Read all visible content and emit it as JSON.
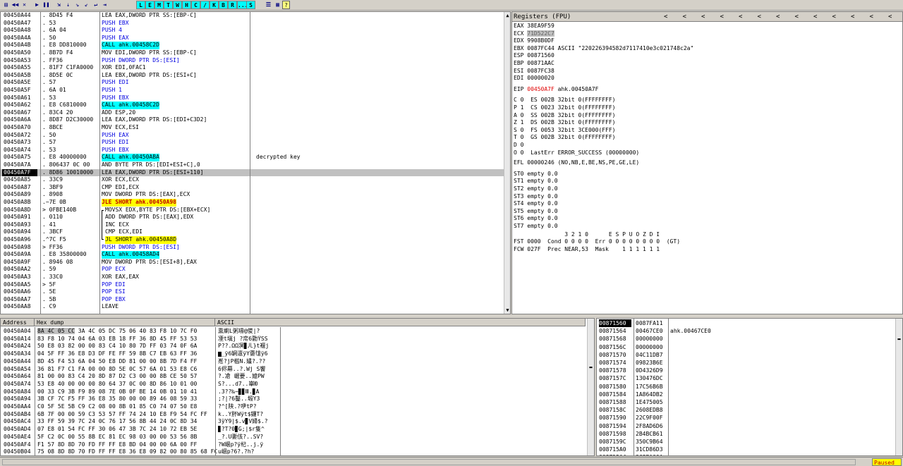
{
  "toolbar": {
    "icons": [
      "folder-open-icon",
      "rewind-icon",
      "close-icon",
      "run-icon",
      "pause-icon",
      "step-into-icon",
      "step-over-icon",
      "trace-into-icon",
      "trace-over-icon",
      "execute-till-return-icon",
      "goto-icon"
    ],
    "letters": [
      "L",
      "E",
      "M",
      "T",
      "W",
      "H",
      "C",
      "/",
      "K",
      "B",
      "R",
      "...",
      "S"
    ],
    "help": "?"
  },
  "disasm": {
    "rows": [
      {
        "addr": "00450A44",
        "hex": ". 8D45 F4",
        "asm": "LEA EAX,DWORD PTR SS:[EBP-C]",
        "kind": "hlmem",
        "cmt": ""
      },
      {
        "addr": "00450A47",
        "hex": ". 53",
        "asm": "PUSH EBX",
        "kind": "push",
        "cmt": ""
      },
      {
        "addr": "00450A48",
        "hex": ". 6A 04",
        "asm": "PUSH 4",
        "kind": "push",
        "cmt": ""
      },
      {
        "addr": "00450A4A",
        "hex": ". 50",
        "asm": "PUSH EAX",
        "kind": "push",
        "cmt": ""
      },
      {
        "addr": "00450A4B",
        "hex": ". E8 DD810000",
        "asm": "CALL ahk.00458C2D",
        "kind": "call",
        "cmt": ""
      },
      {
        "addr": "00450A50",
        "hex": ". 8B7D F4",
        "asm": "MOV EDI,DWORD PTR SS:[EBP-C]",
        "kind": "hlmem2",
        "cmt": ""
      },
      {
        "addr": "00450A53",
        "hex": ". FF36",
        "asm": "PUSH DWORD PTR DS:[ESI]",
        "kind": "push",
        "cmt": ""
      },
      {
        "addr": "00450A55",
        "hex": ". 81F7 C1FA0000",
        "asm": "XOR EDI,0FAC1",
        "kind": "xorimm",
        "cmt": ""
      },
      {
        "addr": "00450A5B",
        "hex": ". 8D5E 0C",
        "asm": "LEA EBX,DWORD PTR DS:[ESI+C]",
        "kind": "plain",
        "cmt": ""
      },
      {
        "addr": "00450A5E",
        "hex": ". 57",
        "asm": "PUSH EDI",
        "kind": "push",
        "cmt": ""
      },
      {
        "addr": "00450A5F",
        "hex": ". 6A 01",
        "asm": "PUSH 1",
        "kind": "push",
        "cmt": ""
      },
      {
        "addr": "00450A61",
        "hex": ". 53",
        "asm": "PUSH EBX",
        "kind": "push",
        "cmt": ""
      },
      {
        "addr": "00450A62",
        "hex": ". E8 C6810000",
        "asm": "CALL ahk.00458C2D",
        "kind": "call",
        "cmt": ""
      },
      {
        "addr": "00450A67",
        "hex": ". 83C4 20",
        "asm": "ADD ESP,20",
        "kind": "addimm",
        "cmt": ""
      },
      {
        "addr": "00450A6A",
        "hex": ". 8D87 D2C30000",
        "asm": "LEA EAX,DWORD PTR DS:[EDI+C3D2]",
        "kind": "plain",
        "cmt": ""
      },
      {
        "addr": "00450A70",
        "hex": ". 8BCE",
        "asm": "MOV ECX,ESI",
        "kind": "plain",
        "cmt": ""
      },
      {
        "addr": "00450A72",
        "hex": ". 50",
        "asm": "PUSH EAX",
        "kind": "push",
        "cmt": ""
      },
      {
        "addr": "00450A73",
        "hex": ". 57",
        "asm": "PUSH EDI",
        "kind": "push",
        "cmt": ""
      },
      {
        "addr": "00450A74",
        "hex": ". 53",
        "asm": "PUSH EBX",
        "kind": "push",
        "cmt": ""
      },
      {
        "addr": "00450A75",
        "hex": ". E8 40000000",
        "asm": "CALL ahk.00450ABA",
        "kind": "call",
        "cmt": "decrypted key"
      },
      {
        "addr": "00450A7A",
        "hex": ". 806437 0C 00",
        "asm": "AND BYTE PTR DS:[EDI+ESI+C],0",
        "kind": "plain",
        "cmt": ""
      },
      {
        "addr": "00450A7F",
        "hex": ". 8D86 10010000",
        "asm": "LEA EAX,DWORD PTR DS:[ESI+110]",
        "kind": "plain",
        "cmt": "",
        "current": true
      },
      {
        "addr": "00450A85",
        "hex": ". 33C9",
        "asm": "XOR ECX,ECX",
        "kind": "plain",
        "cmt": ""
      },
      {
        "addr": "00450A87",
        "hex": ". 3BF9",
        "asm": "CMP EDI,ECX",
        "kind": "plain",
        "cmt": ""
      },
      {
        "addr": "00450A89",
        "hex": ". 8908",
        "asm": "MOV DWORD PTR DS:[EAX],ECX",
        "kind": "plain",
        "cmt": ""
      },
      {
        "addr": "00450A8B",
        "hex": ".~7E 0B",
        "asm": "JLE SHORT ahk.00450A98",
        "kind": "jmp",
        "cmt": ""
      },
      {
        "addr": "00450A8D",
        "hex": "> 0FBE140B",
        "asm": "MOVSX EDX,BYTE PTR DS:[EBX+ECX]",
        "kind": "loop",
        "cmt": ""
      },
      {
        "addr": "00450A91",
        "hex": ". 0110",
        "asm": "ADD DWORD PTR DS:[EAX],EDX",
        "kind": "loop",
        "cmt": ""
      },
      {
        "addr": "00450A93",
        "hex": ". 41",
        "asm": "INC ECX",
        "kind": "loop",
        "cmt": ""
      },
      {
        "addr": "00450A94",
        "hex": ". 3BCF",
        "asm": "CMP ECX,EDI",
        "kind": "loop",
        "cmt": ""
      },
      {
        "addr": "00450A96",
        "hex": ".^7C F5",
        "asm": "JL SHORT ahk.00450A8D",
        "kind": "jmploop",
        "cmt": ""
      },
      {
        "addr": "00450A98",
        "hex": "> FF36",
        "asm": "PUSH DWORD PTR DS:[ESI]",
        "kind": "push",
        "cmt": ""
      },
      {
        "addr": "00450A9A",
        "hex": ". E8 35800000",
        "asm": "CALL ahk.00458AD4",
        "kind": "call",
        "cmt": ""
      },
      {
        "addr": "00450A9F",
        "hex": ". 8946 08",
        "asm": "MOV DWORD PTR DS:[ESI+8],EAX",
        "kind": "plain",
        "cmt": ""
      },
      {
        "addr": "00450AA2",
        "hex": ". 59",
        "asm": "POP ECX",
        "kind": "push",
        "cmt": ""
      },
      {
        "addr": "00450AA3",
        "hex": ". 33C0",
        "asm": "XOR EAX,EAX",
        "kind": "plain",
        "cmt": ""
      },
      {
        "addr": "00450AA5",
        "hex": "> 5F",
        "asm": "POP EDI",
        "kind": "push",
        "cmt": ""
      },
      {
        "addr": "00450AA6",
        "hex": ". 5E",
        "asm": "POP ESI",
        "kind": "push",
        "cmt": ""
      },
      {
        "addr": "00450AA7",
        "hex": ". 5B",
        "asm": "POP EBX",
        "kind": "push",
        "cmt": ""
      },
      {
        "addr": "00450AA8",
        "hex": ". C9",
        "asm": "LEAVE",
        "kind": "plain",
        "cmt": ""
      }
    ]
  },
  "registers": {
    "title": "Registers (FPU)",
    "arrows": [
      "<",
      "<",
      "<",
      "<",
      "<",
      "<",
      "<",
      "<",
      "<",
      "<",
      "<",
      "<",
      "<",
      "<"
    ],
    "gp": [
      {
        "name": "EAX",
        "value": "38EA9F59",
        "note": "",
        "style": ""
      },
      {
        "name": "ECX",
        "value": "71D522C7",
        "note": "",
        "style": "gray"
      },
      {
        "name": "EDX",
        "value": "9908B0DF",
        "note": "",
        "style": ""
      },
      {
        "name": "EBX",
        "value": "0087FC44",
        "note": "ASCII \"220226394582d7117410e3c021748c2a\"",
        "style": ""
      },
      {
        "name": "ESP",
        "value": "00871560",
        "note": "",
        "style": ""
      },
      {
        "name": "EBP",
        "value": "00871AAC",
        "note": "",
        "style": ""
      },
      {
        "name": "ESI",
        "value": "0087FC38",
        "note": "",
        "style": ""
      },
      {
        "name": "EDI",
        "value": "00000020",
        "note": "",
        "style": ""
      }
    ],
    "eip": {
      "name": "EIP",
      "value": "00450A7F",
      "note": "ahk.00450A7F"
    },
    "flags": [
      "C 0  ES 002B 32bit 0(FFFFFFFF)",
      "P 1  CS 0023 32bit 0(FFFFFFFF)",
      "A 0  SS 002B 32bit 0(FFFFFFFF)",
      "Z 1  DS 002B 32bit 0(FFFFFFFF)",
      "S 0  FS 0053 32bit 3CE000(FFF)",
      "T 0  GS 002B 32bit 0(FFFFFFFF)",
      "D 0",
      "O 0  LastErr ERROR_SUCCESS (00000000)"
    ],
    "efl": "EFL 00000246 (NO,NB,E,BE,NS,PE,GE,LE)",
    "fpu": [
      "ST0 empty 0.0",
      "ST1 empty 0.0",
      "ST2 empty 0.0",
      "ST3 empty 0.0",
      "ST4 empty 0.0",
      "ST5 empty 0.0",
      "ST6 empty 0.0",
      "ST7 empty 0.0"
    ],
    "fpu_hdr": "               3 2 1 0      E S P U O Z D I",
    "fst": "FST 0000  Cond 0 0 0 0  Err 0 0 0 0 0 0 0 0  (GT)",
    "fcw": "FCW 027F  Prec NEAR,53  Mask    1 1 1 1 1 1"
  },
  "dump": {
    "col_address": "Address",
    "col_hex": "Hex dump",
    "col_ascii": "ASCII",
    "rows": [
      {
        "addr": "00450A04",
        "hex": "8A 4C 05 CC 3A 4C 05 DC 75 06 40 83 F8 10 7C F0",
        "asc": "熏瘌L粥璹@儍|?"
      },
      {
        "addr": "00450A14",
        "hex": "83 F8 10 74 04 6A 03 EB 18 FF 36 8D 45 FF 53 53",
        "asc": "凐t塡j ?帟6勡ŸSS"
      },
      {
        "addr": "00450A24",
        "hex": "50 E8 03 82 00 00 83 C4 10 80 7D FF 03 74 0F 6A",
        "asc": "P??.ΩΩ凕▊ㄦ}t褗j"
      },
      {
        "addr": "00450A34",
        "hex": "04 5F FF 36 E8 D3 DF FE FF 59 8B C7 EB 63 FF 36",
        "asc": "▆_ÿ6罁邅ÿY嬊隿ÿ6"
      },
      {
        "addr": "00450A44",
        "hex": "8D 45 F4 53 6A 04 50 E8 DD 81 00 00 8B 7D F4 FF",
        "asc": "峞?jP槛Ν.嫿?.??"
      },
      {
        "addr": "00450A54",
        "hex": "36 81 F7 C1 FA 00 00 8D 5E 0C 57 6A 01 53 E8 C6",
        "asc": "6侭幕..?.Wj S饗"
      },
      {
        "addr": "00450A64",
        "hex": "81 00 00 83 C4 20 8D 87 D2 C3 00 00 8B CE 50 57",
        "asc": "?.凔 崌要..嬑PW"
      },
      {
        "addr": "00450A74",
        "hex": "53 E8 40 00 00 00 80 64 37 0C 00 8D 86 10 01 00",
        "asc": "S?...d7..崋Ю"
      },
      {
        "addr": "00450A84",
        "hex": "00 33 C9 3B F9 89 08 7E 0B 0F BE 14 0B 01 10 41",
        "asc": ".3??‰~▊▊Ⅲ.▊A"
      },
      {
        "addr": "00450A94",
        "hex": "3B CF 7C F5 FF 36 E8 35 80 00 00 89 46 08 59 33",
        "asc": ";?|?6鑿..塅Y3"
      },
      {
        "addr": "00450AA4",
        "hex": "C0 5F 5E 5B C9 C2 08 00 8B 01 85 C0 74 07 50 E8",
        "asc": "?^[陕.?吚tP?"
      },
      {
        "addr": "00450AB4",
        "hex": "6B 7F 00 00 59 C3 53 57 FF 74 24 10 E8 F9 54 FC FF",
        "asc": "k..Y肧Wÿt$鑼T?"
      },
      {
        "addr": "00450AC4",
        "hex": "33 FF 59 39 7C 24 0C 76 17 56 8B 44 24 0C 8D 34",
        "asc": "3ÿY9|$.v▊V婦$.?"
      },
      {
        "addr": "00450AD4",
        "hex": "07 E8 01 54 FC FF 30 06 47 3B 7C 24 10 72 EB 5E",
        "asc": "▊?T?0▊G;|$r隻^"
      },
      {
        "addr": "00450AE4",
        "hex": "5F C2 0C 00 55 8B EC 81 EC 98 03 00 00 53 56 8B",
        "asc": "_?.U嬱侅?..SV?"
      },
      {
        "addr": "00450AF4",
        "hex": "F1 57 8D 8D 70 FD FF FF E8 BD 04 00 00 6A 00 FF",
        "asc": "?W崓p?ÿ杞..j.ÿ"
      },
      {
        "addr": "00450B04",
        "hex": "75 08 8D 8D 70 FD FF FF E8 36 E8 09 82 00 80 85 68 FC",
        "asc": "u崓p?6?.?h?"
      }
    ]
  },
  "stack": {
    "rows": [
      {
        "addr": "00871560",
        "val": "0087FA11",
        "cmt": "",
        "top": true
      },
      {
        "addr": "00871564",
        "val": "00467CE0",
        "cmt": "ahk.00467CE0",
        "top": false
      },
      {
        "addr": "00871568",
        "val": "00000000",
        "cmt": "",
        "top": false
      },
      {
        "addr": "0087156C",
        "val": "00000000",
        "cmt": "",
        "top": false
      },
      {
        "addr": "00871570",
        "val": "04C11DB7",
        "cmt": "",
        "top": false
      },
      {
        "addr": "00871574",
        "val": "09823B6E",
        "cmt": "",
        "top": false
      },
      {
        "addr": "00871578",
        "val": "0D4326D9",
        "cmt": "",
        "top": false
      },
      {
        "addr": "0087157C",
        "val": "130476DC",
        "cmt": "",
        "top": false
      },
      {
        "addr": "00871580",
        "val": "17C56B6B",
        "cmt": "",
        "top": false
      },
      {
        "addr": "00871584",
        "val": "1A864DB2",
        "cmt": "",
        "top": false
      },
      {
        "addr": "00871588",
        "val": "1E475005",
        "cmt": "",
        "top": false
      },
      {
        "addr": "0087158C",
        "val": "2608EDB8",
        "cmt": "",
        "top": false
      },
      {
        "addr": "00871590",
        "val": "22C9F00F",
        "cmt": "",
        "top": false
      },
      {
        "addr": "00871594",
        "val": "2F8AD6D6",
        "cmt": "",
        "top": false
      },
      {
        "addr": "00871598",
        "val": "2B4BCB61",
        "cmt": "",
        "top": false
      },
      {
        "addr": "0087159C",
        "val": "350C9B64",
        "cmt": "",
        "top": false
      },
      {
        "addr": "008715A0",
        "val": "31CD86D3",
        "cmt": "",
        "top": false
      },
      {
        "addr": "008715A4",
        "val": "3C8EA00A",
        "cmt": "",
        "top": false
      }
    ]
  },
  "status": {
    "state": "Paused"
  }
}
